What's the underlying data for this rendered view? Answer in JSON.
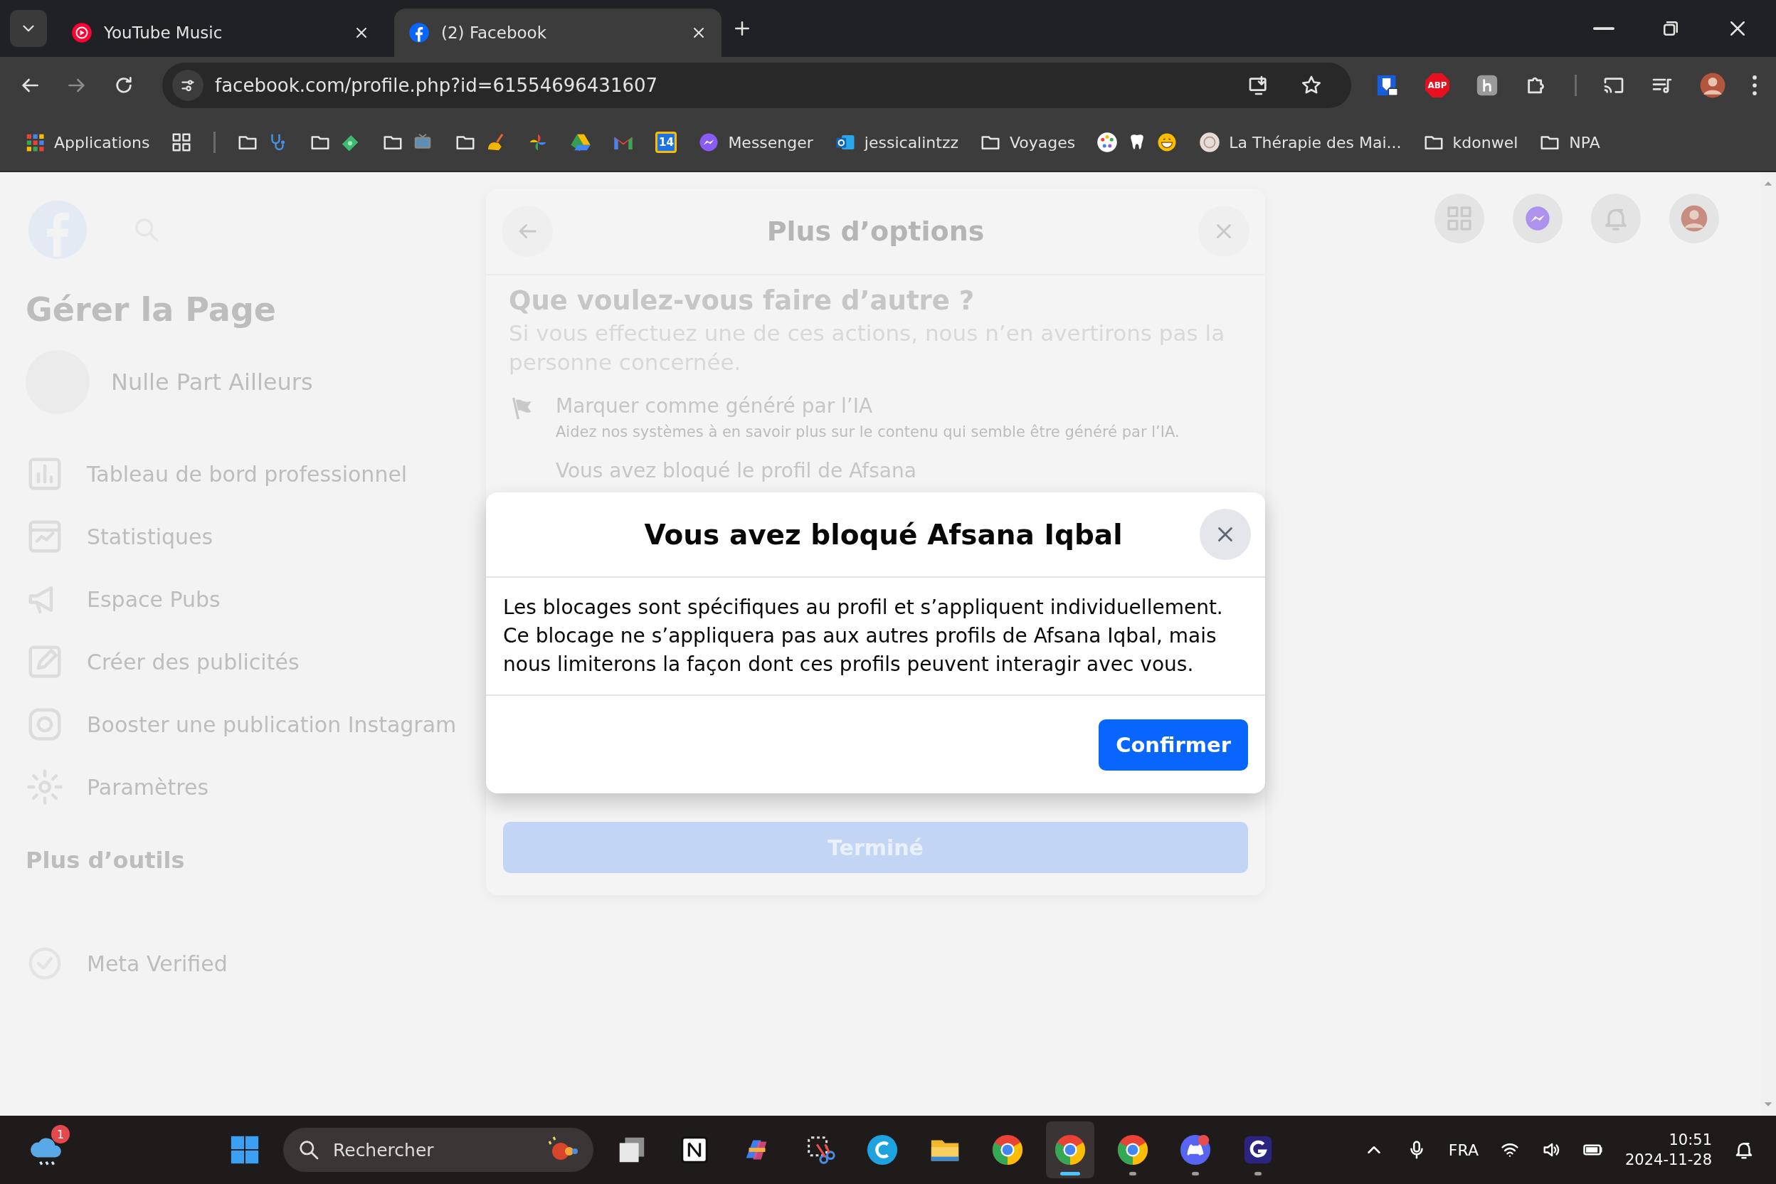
{
  "browser": {
    "tabs": [
      {
        "title": "YouTube Music",
        "selected": false
      },
      {
        "title": "(2) Facebook",
        "selected": true
      }
    ],
    "url": "facebook.com/profile.php?id=61554696431607",
    "adblock_label": "ABP",
    "bookmarks": [
      {
        "kind": "link",
        "label": "Applications"
      },
      {
        "kind": "link"
      },
      {
        "kind": "separator"
      },
      {
        "kind": "folder"
      },
      {
        "kind": "folder"
      },
      {
        "kind": "folder"
      },
      {
        "kind": "folder"
      },
      {
        "kind": "link"
      },
      {
        "kind": "link"
      },
      {
        "kind": "link"
      },
      {
        "kind": "calendar",
        "label": "14"
      },
      {
        "kind": "link",
        "label": "Messenger"
      },
      {
        "kind": "link",
        "label": "jessicalintzz"
      },
      {
        "kind": "folder",
        "label": "Voyages"
      },
      {
        "kind": "link"
      },
      {
        "kind": "link",
        "label": "La Thérapie des Mai..."
      },
      {
        "kind": "folder",
        "label": "kdonwel"
      },
      {
        "kind": "folder",
        "label": "NPA"
      }
    ]
  },
  "page": {
    "sidebar": {
      "title": "Gérer la Page",
      "page_name": "Nulle Part Ailleurs",
      "items": [
        {
          "label": "Tableau de bord professionnel"
        },
        {
          "label": "Statistiques"
        },
        {
          "label": "Espace Pubs"
        },
        {
          "label": "Créer des publicités"
        },
        {
          "label": "Booster une publication Instagram"
        },
        {
          "label": "Paramètres"
        }
      ],
      "more_title": "Plus d’outils",
      "verified": "Meta Verified"
    }
  },
  "options_dialog": {
    "title": "Plus d’options",
    "heading": "Que voulez-vous faire d’autre ?",
    "subtitle": "Si vous effectuez une de ces actions, nous n’en avertirons pas la personne concernée.",
    "items": [
      {
        "title": "Marquer comme généré par l’IA",
        "description": "Aidez nos systèmes à en savoir plus sur le contenu qui semble être généré par l’IA."
      },
      {
        "title": "Vous avez bloqué le profil de Afsana"
      }
    ],
    "done_button": {
      "label": "Terminé",
      "disabled": true
    }
  },
  "block_dialog": {
    "title": "Vous avez bloqué Afsana Iqbal",
    "body": "Les blocages sont spécifiques au profil et s’appliquent individuellement. Ce blocage ne s’appliquera pas aux autres profils de Afsana Iqbal, mais nous limiterons la façon dont ces profils peuvent interagir avec vous.",
    "confirm": "Confirmer"
  },
  "taskbar": {
    "weather_badge": "1",
    "search_placeholder": "Rechercher",
    "apps": [
      {
        "open": false,
        "active": false
      },
      {
        "open": false,
        "active": false
      },
      {
        "open": false,
        "active": false
      },
      {
        "open": false,
        "active": false
      },
      {
        "open": false,
        "active": false
      },
      {
        "open": false,
        "active": false
      },
      {
        "open": false,
        "active": false
      },
      {
        "open": true,
        "active": true
      },
      {
        "open": true,
        "active": false
      },
      {
        "open": true,
        "active": false
      },
      {
        "open": true,
        "active": false
      }
    ],
    "language": "FRA",
    "time": "10:51",
    "date": "2024-11-28"
  }
}
